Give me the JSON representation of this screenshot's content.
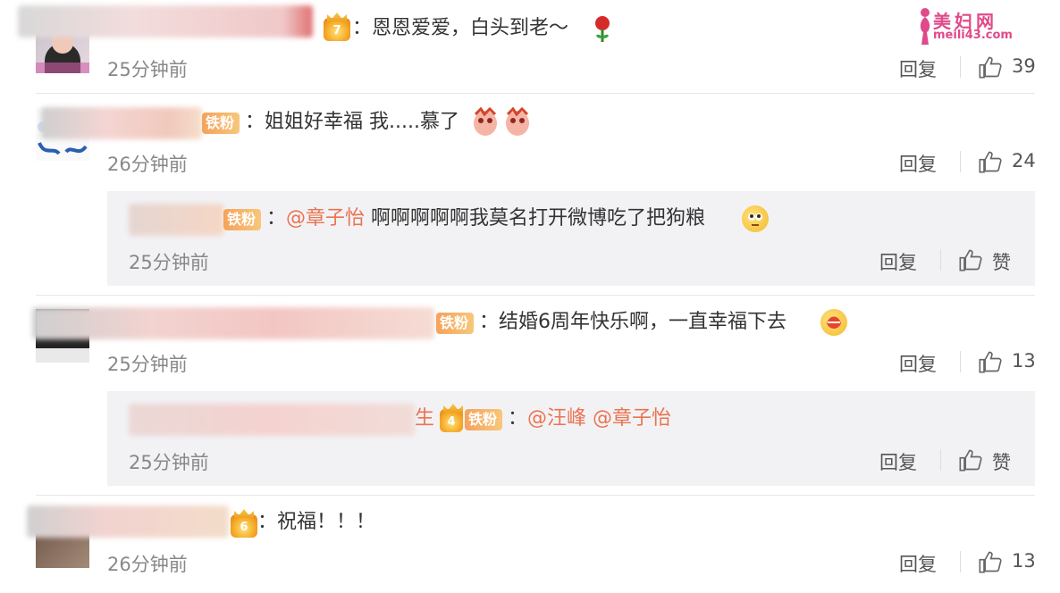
{
  "watermark": {
    "title": "美妇网",
    "url": "meili43.com"
  },
  "comments": [
    {
      "text": "：恩恩爱爱，白头到老～",
      "time": "25分钟前",
      "reply": "回复",
      "likes": "39"
    },
    {
      "text": "：姐姐好幸福 我.....慕了",
      "badge": "铁粉",
      "time": "26分钟前",
      "reply": "回复",
      "likes": "24",
      "sub": {
        "badge": "铁粉",
        "mention": "@章子怡",
        "text": " 啊啊啊啊啊我莫名打开微博吃了把狗粮",
        "time": "25分钟前",
        "reply": "回复",
        "like": "赞"
      }
    },
    {
      "text": "：结婚6周年快乐啊，一直幸福下去",
      "badge": "铁粉",
      "time": "25分钟前",
      "reply": "回复",
      "likes": "13",
      "sub": {
        "prefix": "生",
        "badge": "铁粉",
        "mention1": "@汪峰",
        "mention2": "@章子怡",
        "time": "25分钟前",
        "reply": "回复",
        "like": "赞"
      }
    },
    {
      "text": "：祝福！！！",
      "time": "26分钟前",
      "reply": "回复",
      "likes": "13"
    }
  ],
  "colors": {
    "mention": "#eb7350",
    "fan_badge": "#f5a35c",
    "reply_bg": "#f2f2f5"
  }
}
